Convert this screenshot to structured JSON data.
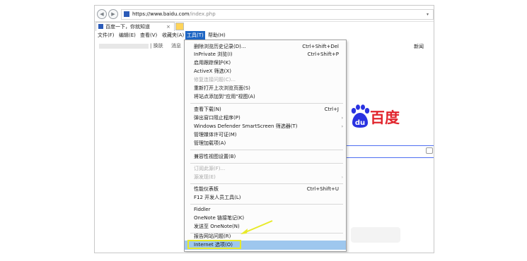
{
  "browser": {
    "url_host": "https://www.baidu.com",
    "url_path": "/index.php",
    "tab_title": "百度一下，你就知道",
    "tab_close": "×"
  },
  "menubar": [
    {
      "label": "文件(F)"
    },
    {
      "label": "编辑(E)"
    },
    {
      "label": "查看(V)"
    },
    {
      "label": "收藏夹(A)"
    },
    {
      "label": "工具(T)",
      "active": true
    },
    {
      "label": "帮助(H)"
    }
  ],
  "page": {
    "top_links": [
      "| 换肤",
      "消息"
    ],
    "news_link": "新闻",
    "logo_text": "百度"
  },
  "tools_menu": {
    "items": [
      {
        "label": "删除浏览历史记录(D)...",
        "shortcut": "Ctrl+Shift+Del"
      },
      {
        "label": "InPrivate 浏览(I)",
        "shortcut": "Ctrl+Shift+P"
      },
      {
        "label": "启用跟踪保护(K)"
      },
      {
        "label": "ActiveX 筛选(X)"
      },
      {
        "label": "修复连接问题(C)...",
        "disabled": true
      },
      {
        "label": "重新打开上次浏览页面(S)"
      },
      {
        "label": "将站点添加到\"应用\"视图(A)"
      },
      {
        "label": "查看下载(N)",
        "shortcut": "Ctrl+J"
      },
      {
        "label": "弹出窗口阻止程序(P)",
        "arrow": "›"
      },
      {
        "label": "Windows Defender SmartScreen 筛选器(T)",
        "arrow": "›"
      },
      {
        "label": "管理媒体许可证(M)"
      },
      {
        "label": "管理加载项(A)"
      },
      {
        "label": "兼容性视图设置(B)"
      },
      {
        "label": "订阅此源(F)...",
        "disabled": true
      },
      {
        "label": "源发现(E)",
        "disabled": true,
        "arrow": "›"
      },
      {
        "label": "性能仪表板",
        "shortcut": "Ctrl+Shift+U"
      },
      {
        "label": "F12 开发人员工具(L)"
      },
      {
        "label": "Fiddler"
      },
      {
        "label": "OneNote 链接笔记(K)"
      },
      {
        "label": "发送至 OneNote(N)"
      },
      {
        "label": "报告网站问题(R)"
      },
      {
        "label": "Internet 选项(O)",
        "highlighted": true
      }
    ]
  },
  "colors": {
    "menu_active": "#1e66c4",
    "highlight_row": "#9ec7ee",
    "annotation": "#e8ea2a",
    "baidu_red": "#e1252d",
    "baidu_blue": "#2932e1"
  },
  "icons": [
    "back-icon",
    "forward-icon",
    "site-icon",
    "dropdown-icon",
    "camera-icon",
    "submenu-arrow-icon",
    "annotation-arrow-icon"
  ]
}
